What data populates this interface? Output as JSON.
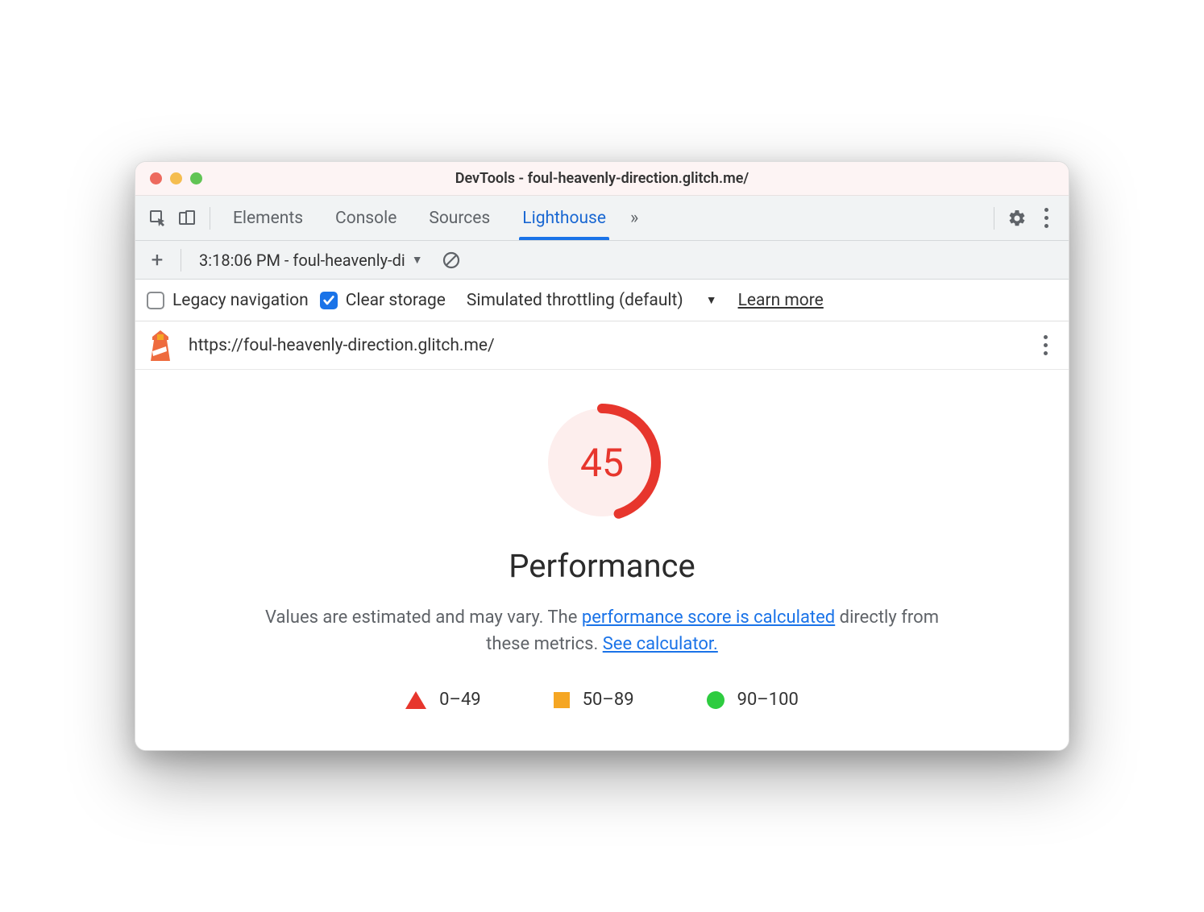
{
  "window": {
    "title": "DevTools - foul-heavenly-direction.glitch.me/"
  },
  "tabs": {
    "items": [
      "Elements",
      "Console",
      "Sources",
      "Lighthouse"
    ],
    "active": "Lighthouse",
    "more_glyph": "»"
  },
  "secondary": {
    "report_label": "3:18:06 PM - foul-heavenly-di"
  },
  "options": {
    "legacy_nav_label": "Legacy navigation",
    "legacy_nav_checked": false,
    "clear_storage_label": "Clear storage",
    "clear_storage_checked": true,
    "throttling_label": "Simulated throttling (default)",
    "learn_more": "Learn more"
  },
  "url_bar": {
    "url": "https://foul-heavenly-direction.glitch.me/"
  },
  "report": {
    "score": "45",
    "score_percent": 45,
    "heading": "Performance",
    "desc_prefix": "Values are estimated and may vary. The ",
    "link1": "performance score is calculated",
    "desc_mid": " directly from these metrics. ",
    "link2": "See calculator.",
    "legend": {
      "low": "0–49",
      "mid": "50–89",
      "high": "90–100"
    }
  },
  "colors": {
    "fail": "#e7362d",
    "warn": "#f5a623",
    "pass": "#2ecc40",
    "link": "#1a73e8"
  }
}
